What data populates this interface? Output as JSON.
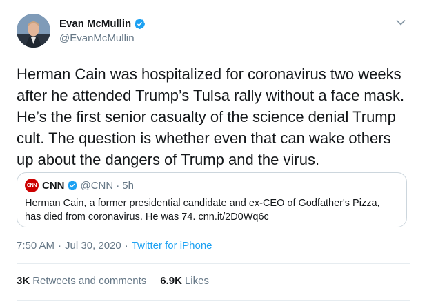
{
  "author": {
    "name": "Evan McMullin",
    "handle": "@EvanMcMullin",
    "verified_icon": "verified-badge-icon"
  },
  "tweet": {
    "text": "Herman Cain was hospitalized for coronavirus two weeks\nafter he attended Trump’s Tulsa rally without a face mask.\nHe’s the first senior casualty of the science denial Trump\ncult. The question is whether even that can wake others\nup about the dangers of Trump and the virus."
  },
  "quoted": {
    "logo": "CNN",
    "name": "CNN",
    "handle": "@CNN",
    "dot": "·",
    "time": "5h",
    "text": "Herman Cain, a former presidential candidate and ex-CEO of Godfather's Pizza,\nhas died from coronavirus. He was 74. cnn.it/2D0Wq6c"
  },
  "meta": {
    "time": "7:50 AM",
    "sep1": "·",
    "date": "Jul 30, 2020",
    "sep2": "·",
    "source": "Twitter for iPhone"
  },
  "stats": {
    "retweets_count": "3K",
    "retweets_label": "Retweets and comments",
    "likes_count": "6.9K",
    "likes_label": "Likes"
  },
  "colors": {
    "verified_blue": "#1da1f2",
    "cnn_red": "#cc0000",
    "muted": "#657786"
  }
}
